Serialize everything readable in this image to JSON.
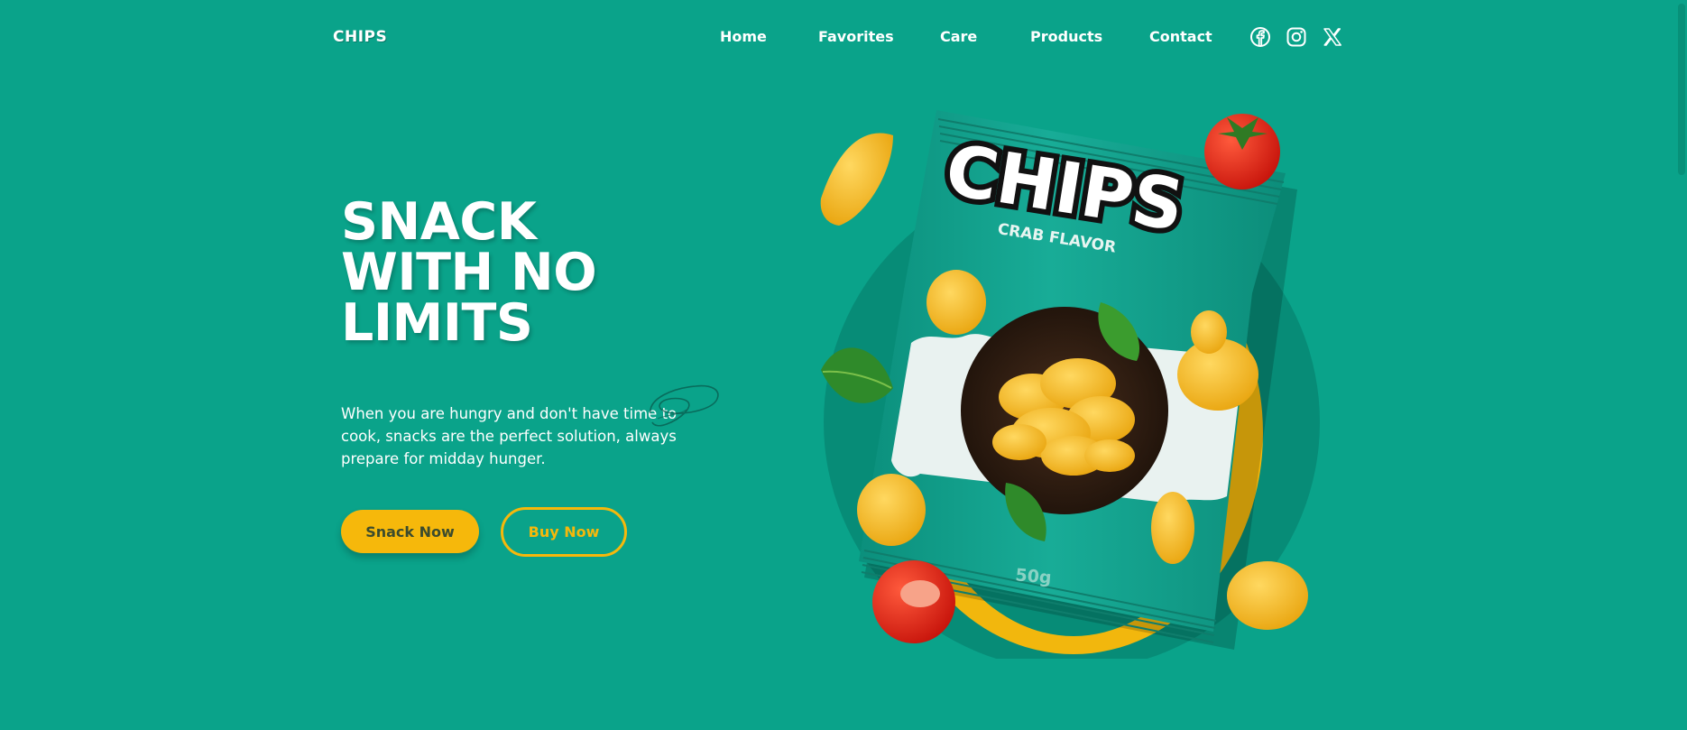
{
  "header": {
    "logo": "CHIPS",
    "nav": [
      "Home",
      "Favorites",
      "Care",
      "Products",
      "Contact"
    ],
    "social_icons": [
      "facebook-icon",
      "instagram-icon",
      "x-icon"
    ]
  },
  "hero": {
    "title_lines": [
      "SNACK",
      "WITH NO",
      "LIMITS"
    ],
    "description": "When you are hungry and don't have time to cook, snacks are the perfect solution, always prepare for midday hunger.",
    "primary_button": "Snack Now",
    "secondary_button": "Buy Now"
  },
  "product": {
    "brand": "CHIPS",
    "flavor": "CRAB FLAVOR",
    "weight": "50g"
  },
  "colors": {
    "background": "#0aa38a",
    "accent": "#f6b80b",
    "bag": "#13a38f",
    "text": "#ffffff"
  }
}
